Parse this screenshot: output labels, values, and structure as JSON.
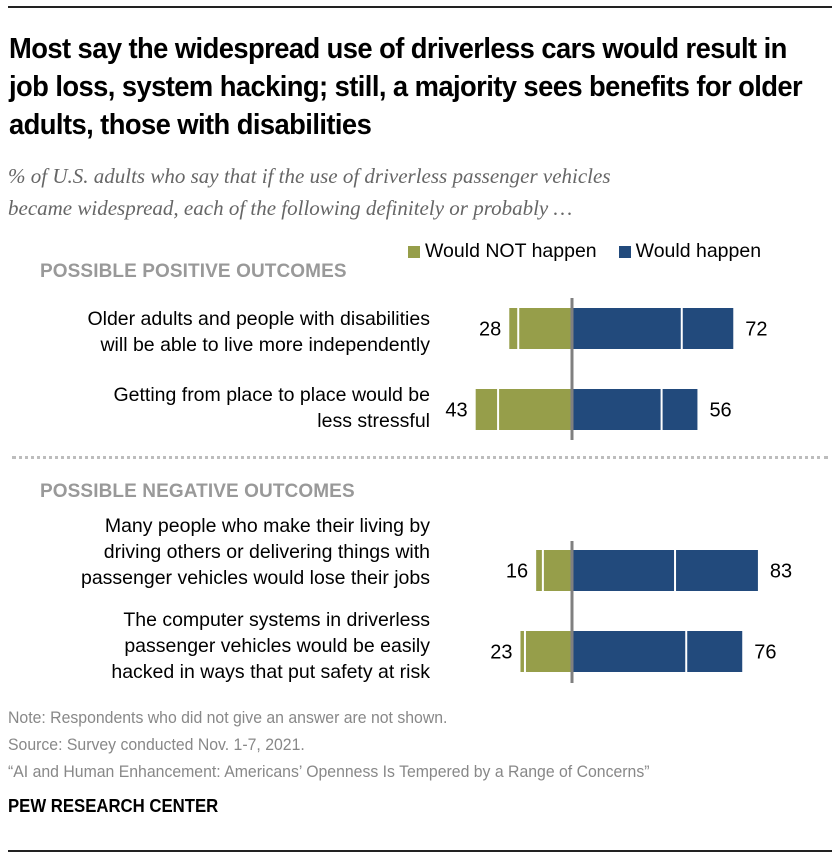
{
  "title": "Most say the widespread use of driverless cars would result in job loss, system hacking; still, a majority sees benefits for older adults, those with disabilities",
  "subtitle_line1": "% of U.S. adults who say that if the use of driverless passenger vehicles",
  "subtitle_line2": "became widespread, each of the following definitely or probably …",
  "legend": [
    {
      "label": "Would NOT happen",
      "color": "#969e4a"
    },
    {
      "label": "Would happen",
      "color": "#224a7c"
    }
  ],
  "colors": {
    "not_happen": "#969e4a",
    "happen": "#224a7c",
    "axis": "#808080",
    "separator": "#ffffff"
  },
  "sections": [
    {
      "heading": "POSSIBLE POSITIVE OUTCOMES"
    },
    {
      "heading": "POSSIBLE NEGATIVE OUTCOMES"
    }
  ],
  "rows": [
    {
      "lines": [
        "Older adults and people with disabilities",
        "will be able to live more independently"
      ]
    },
    {
      "lines": [
        "Getting from place to place would be",
        "less stressful"
      ]
    },
    {
      "lines": [
        "Many people who make their living by",
        "driving others or delivering things with",
        "passenger vehicles would lose their jobs"
      ]
    },
    {
      "lines": [
        "The computer systems in driverless",
        "passenger vehicles would be easily",
        "hacked in ways that put safety at risk"
      ]
    }
  ],
  "chart_data": {
    "type": "bar",
    "orientation": "horizontal-diverging",
    "title": "Most say the widespread use of driverless cars would result in job loss, system hacking; still, a majority sees benefits for older adults, those with disabilities",
    "xlabel": "",
    "ylabel": "",
    "legend_position": "top-right",
    "grid": false,
    "categories": [
      "Older adults and people with disabilities will be able to live more independently",
      "Getting from place to place would be less stressful",
      "Many people who make their living by driving others or delivering things with passenger vehicles would lose their jobs",
      "The computer systems in driverless passenger vehicles would be easily hacked in ways that put safety at risk"
    ],
    "groups": [
      "POSSIBLE POSITIVE OUTCOMES",
      "POSSIBLE POSITIVE OUTCOMES",
      "POSSIBLE NEGATIVE OUTCOMES",
      "POSSIBLE NEGATIVE OUTCOMES"
    ],
    "series": [
      {
        "name": "Would NOT happen",
        "values": [
          28,
          43,
          16,
          23
        ],
        "segments": {
          "definitely_not": [
            4,
            10,
            3,
            2
          ],
          "probably_not": [
            24,
            33,
            13,
            21
          ]
        }
      },
      {
        "name": "Would happen",
        "values": [
          72,
          56,
          83,
          76
        ],
        "segments": {
          "definitely": [
            49,
            40,
            46,
            51
          ],
          "probably": [
            23,
            16,
            37,
            25
          ]
        }
      }
    ],
    "value_labels": {
      "not_happen": [
        "28",
        "43",
        "16",
        "23"
      ],
      "happen": [
        "72",
        "56",
        "83",
        "76"
      ]
    },
    "xlim": [
      -50,
      100
    ]
  },
  "footer": {
    "note": "Note: Respondents who did not give an answer are not shown.",
    "source": "Source: Survey conducted Nov. 1-7, 2021.",
    "report": "“AI and Human Enhancement: Americans’ Openness Is Tempered by a Range of Concerns”",
    "brand": "PEW RESEARCH CENTER"
  }
}
